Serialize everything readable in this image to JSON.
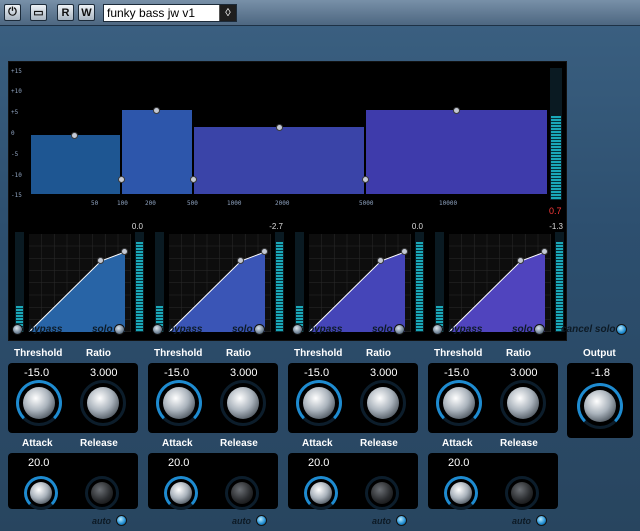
{
  "toolbar": {
    "power_glyph": "⏻",
    "preset_mgr_glyph": "▭",
    "read_label": "R",
    "write_label": "W",
    "preset_name": "funky bass jw v1",
    "preset_arrow_glyph": "◊"
  },
  "spectrum": {
    "db_labels": [
      "+15",
      "+10",
      "+5",
      "0",
      "-5",
      "-10",
      "-15"
    ],
    "freq_labels": [
      "50",
      "100",
      "200",
      "500",
      "1000",
      "2000",
      "5000",
      "10000"
    ],
    "output_peak": "0.7",
    "bands": [
      {
        "level": 0.45
      },
      {
        "level": 0.7
      },
      {
        "level": 0.55
      },
      {
        "level": 0.7
      }
    ]
  },
  "bands": [
    {
      "gain_readout": "0.0",
      "bypass": "bypass",
      "solo": "solo",
      "threshold_label": "Threshold",
      "threshold": "-15.0",
      "ratio_label": "Ratio",
      "ratio": "3.000",
      "attack_label": "Attack",
      "attack": "20.0",
      "release_label": "Release",
      "auto": "auto",
      "color": "#2864a6"
    },
    {
      "gain_readout": "-2.7",
      "bypass": "bypass",
      "solo": "solo",
      "threshold_label": "Threshold",
      "threshold": "-15.0",
      "ratio_label": "Ratio",
      "ratio": "3.000",
      "attack_label": "Attack",
      "attack": "20.0",
      "release_label": "Release",
      "auto": "auto",
      "color": "#3a55b6"
    },
    {
      "gain_readout": "0.0",
      "bypass": "bypass",
      "solo": "solo",
      "threshold_label": "Threshold",
      "threshold": "-15.0",
      "ratio_label": "Ratio",
      "ratio": "3.000",
      "attack_label": "Attack",
      "attack": "20.0",
      "release_label": "Release",
      "auto": "auto",
      "color": "#4545b8"
    },
    {
      "gain_readout": "-1.3",
      "bypass": "bypass",
      "solo": "solo",
      "threshold_label": "Threshold",
      "threshold": "-15.0",
      "ratio_label": "Ratio",
      "ratio": "3.000",
      "attack_label": "Attack",
      "attack": "20.0",
      "release_label": "Release",
      "auto": "auto",
      "color": "#5044be"
    }
  ],
  "output": {
    "cancel_solo": "cancel solo",
    "output_label": "Output",
    "output_value": "-1.8"
  },
  "colors": {
    "accent": "#1e8bd0",
    "meter": "#1aa8b9",
    "peak": "#ff3a3a"
  }
}
